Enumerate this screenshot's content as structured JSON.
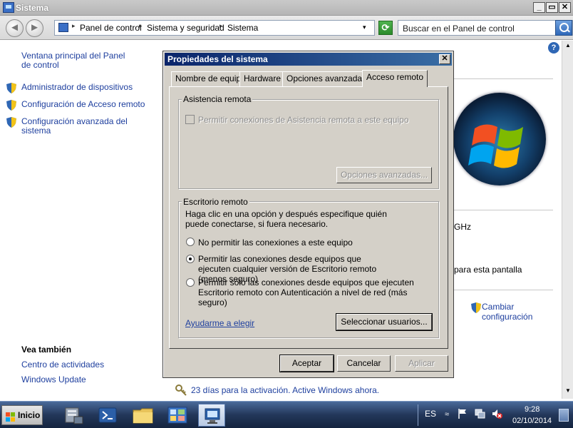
{
  "window": {
    "title": "Sistema",
    "minimize": "_",
    "maximize": "▭",
    "close": "✕"
  },
  "nav": {
    "back": "◄",
    "forward": "►",
    "crumbs": [
      "Panel de control",
      "Sistema y seguridad",
      "Sistema"
    ],
    "crumb_sep": "▸",
    "dropdown": "▾",
    "refresh": "⟳",
    "search_placeholder": "Buscar en el Panel de control"
  },
  "left": {
    "home_link": "Ventana principal del Panel de control",
    "links": [
      "Administrador de dispositivos",
      "Configuración de Acceso remoto",
      "Configuración avanzada del sistema"
    ],
    "see_also_title": "Vea también",
    "see_also": [
      "Centro de actividades",
      "Windows Update"
    ]
  },
  "content": {
    "peek_ghz": "GHz",
    "peek_screen": "para esta pantalla",
    "change_config": "Cambiar configuración",
    "activation": "23 días para la activación. Active Windows ahora.",
    "help": "?"
  },
  "dialog": {
    "title": "Propiedades del sistema",
    "close": "✕",
    "tabs": [
      "Nombre de equipo",
      "Hardware",
      "Opciones avanzadas",
      "Acceso remoto"
    ],
    "active_tab": "Acceso remoto",
    "assist": {
      "group_label": "Asistencia remota",
      "checkbox_label": "Permitir conexiones de Asistencia remota a este equipo",
      "checked": false,
      "advanced_button": "Opciones avanzadas..."
    },
    "desktop": {
      "group_label": "Escritorio remoto",
      "intro": "Haga clic en una opción y después especifique quién puede conectarse, si fuera necesario.",
      "options": [
        "No permitir las conexiones a este equipo",
        "Permitir las conexiones desde equipos que ejecuten cualquier versión de Escritorio remoto (menos seguro)",
        "Permitir sólo las conexiones desde equipos que ejecuten Escritorio remoto con Autenticación a nivel de red (más seguro)"
      ],
      "selected_option": 1,
      "help_link": "Ayudarme a elegir",
      "select_users_button": "Seleccionar usuarios..."
    },
    "buttons": {
      "ok": "Aceptar",
      "cancel": "Cancelar",
      "apply": "Aplicar"
    }
  },
  "taskbar": {
    "start": "Inicio",
    "language": "ES",
    "time": "9:28",
    "date": "02/10/2014",
    "show_hidden": "≈"
  }
}
